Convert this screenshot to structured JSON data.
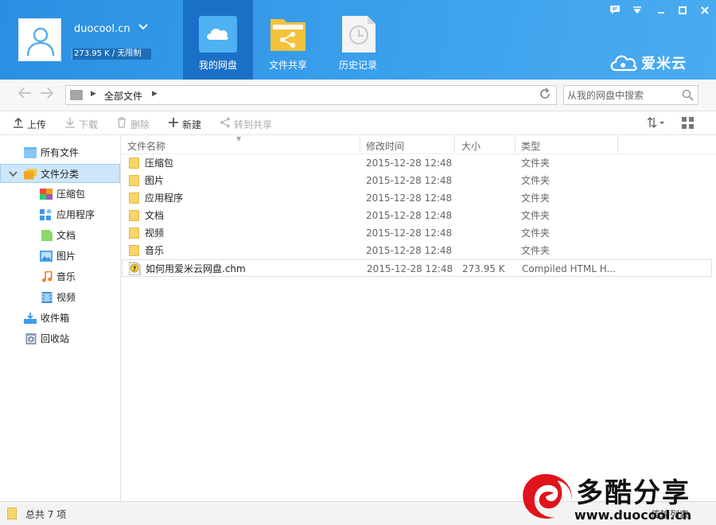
{
  "header": {
    "username": "duocool.cn",
    "quota_text": "273.95 K / 无限制",
    "nav_tabs": [
      {
        "label": "我的网盘",
        "icon": "cloud-icon",
        "active": true
      },
      {
        "label": "文件共享",
        "icon": "share-folder-icon",
        "active": false
      },
      {
        "label": "历史记录",
        "icon": "history-clock-icon",
        "active": false
      }
    ],
    "brand": "爱米云"
  },
  "address_bar": {
    "breadcrumb": "全部文件",
    "search_placeholder": "从我的网盘中搜索"
  },
  "toolbar": {
    "upload": "上传",
    "download": "下载",
    "delete": "删除",
    "new": "新建",
    "share": "转到共享"
  },
  "sidebar": {
    "all_files": "所有文件",
    "categories": "文件分类",
    "sub_items": [
      {
        "label": "压缩包",
        "icon": "archive-icon"
      },
      {
        "label": "应用程序",
        "icon": "app-icon"
      },
      {
        "label": "文档",
        "icon": "document-icon"
      },
      {
        "label": "图片",
        "icon": "image-icon"
      },
      {
        "label": "音乐",
        "icon": "music-icon"
      },
      {
        "label": "视频",
        "icon": "video-icon"
      }
    ],
    "inbox": "收件箱",
    "recycle": "回收站"
  },
  "file_list": {
    "columns": [
      "文件名称",
      "修改时间",
      "大小",
      "类型"
    ],
    "rows": [
      {
        "name": "压缩包",
        "date": "2015-12-28 12:48",
        "size": "",
        "type": "文件夹",
        "icon": "folder-icon"
      },
      {
        "name": "图片",
        "date": "2015-12-28 12:48",
        "size": "",
        "type": "文件夹",
        "icon": "folder-icon"
      },
      {
        "name": "应用程序",
        "date": "2015-12-28 12:48",
        "size": "",
        "type": "文件夹",
        "icon": "folder-icon"
      },
      {
        "name": "文档",
        "date": "2015-12-28 12:48",
        "size": "",
        "type": "文件夹",
        "icon": "folder-icon"
      },
      {
        "name": "视频",
        "date": "2015-12-28 12:48",
        "size": "",
        "type": "文件夹",
        "icon": "folder-icon"
      },
      {
        "name": "音乐",
        "date": "2015-12-28 12:48",
        "size": "",
        "type": "文件夹",
        "icon": "folder-icon"
      },
      {
        "name": "如何用爱米云网盘.chm",
        "date": "2015-12-28 12:48",
        "size": "273.95 K",
        "type": "Compiled HTML H...",
        "icon": "chm-help-icon"
      }
    ]
  },
  "status": {
    "total": "总共 7 项",
    "transfer_list": "传输列表"
  },
  "watermark": {
    "title": "多酷分享",
    "url": "www.duocool.cn"
  },
  "colors": {
    "header_blue": "#3ba0ec",
    "active_tab": "#1a70c7",
    "selection": "#cde6fb",
    "folder": "#f7d56a"
  }
}
